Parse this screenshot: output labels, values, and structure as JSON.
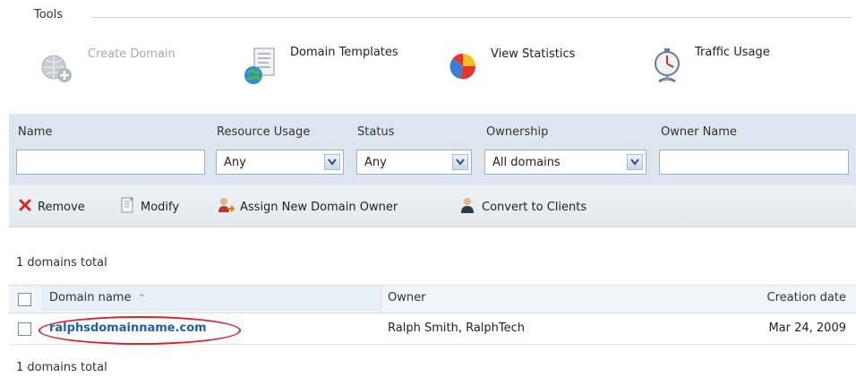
{
  "tools": {
    "title": "Tools",
    "items": [
      {
        "label": "Create Domain",
        "icon": "globe-add-icon",
        "enabled": false
      },
      {
        "label": "Domain Templates",
        "icon": "document-globe-icon",
        "enabled": true
      },
      {
        "label": "View Statistics",
        "icon": "pie-chart-icon",
        "enabled": true
      },
      {
        "label": "Traffic Usage",
        "icon": "stopwatch-icon",
        "enabled": true
      }
    ]
  },
  "filters": {
    "name_label": "Name",
    "name_value": "",
    "resource_label": "Resource Usage",
    "resource_value": "Any",
    "status_label": "Status",
    "status_value": "Any",
    "ownership_label": "Ownership",
    "ownership_value": "All domains",
    "owner_name_label": "Owner Name",
    "owner_name_value": ""
  },
  "actions": {
    "remove": "Remove",
    "modify": "Modify",
    "assign": "Assign New Domain Owner",
    "convert": "Convert to Clients"
  },
  "table": {
    "total_top": "1 domains total",
    "total_bottom": "1 domains total",
    "columns": {
      "domain": "Domain name",
      "sort_indicator": "^",
      "owner": "Owner",
      "created": "Creation date"
    },
    "rows": [
      {
        "domain": "ralphsdomainname.com",
        "owner": "Ralph Smith, RalphTech",
        "created": "Mar 24, 2009",
        "highlighted": true
      }
    ]
  },
  "colors": {
    "filter_bg": "#dde6ee",
    "link": "#1f5fae",
    "highlight_oval": "#d9252a",
    "remove_icon": "#d9252a"
  }
}
